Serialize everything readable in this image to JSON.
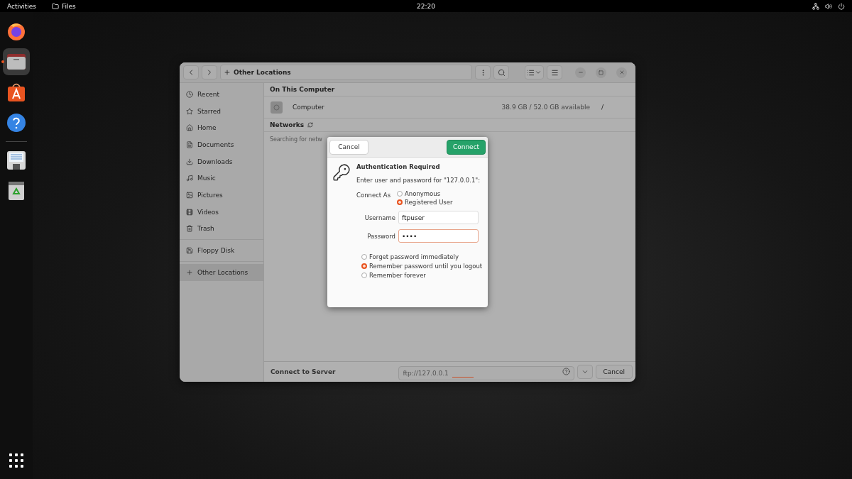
{
  "top_bar": {
    "activities": "Activities",
    "app_name": "Files",
    "clock": "22:20"
  },
  "dock": {
    "apps": [
      {
        "kind": "browser",
        "running": false
      },
      {
        "kind": "files",
        "running": true
      },
      {
        "kind": "store",
        "running": false
      },
      {
        "kind": "help",
        "running": false
      },
      {
        "kind": "floppy",
        "running": false
      },
      {
        "kind": "trash",
        "running": false
      }
    ]
  },
  "files_window": {
    "path": "Other Locations",
    "sidebar": [
      {
        "kind": "recent",
        "label": "Recent",
        "selected": false
      },
      {
        "kind": "starred",
        "label": "Starred",
        "selected": false
      },
      {
        "kind": "home",
        "label": "Home",
        "selected": false
      },
      {
        "kind": "documents",
        "label": "Documents",
        "selected": false
      },
      {
        "kind": "downloads",
        "label": "Downloads",
        "selected": false
      },
      {
        "kind": "music",
        "label": "Music",
        "selected": false
      },
      {
        "kind": "pictures",
        "label": "Pictures",
        "selected": false
      },
      {
        "kind": "videos",
        "label": "Videos",
        "selected": false
      },
      {
        "kind": "trash",
        "label": "Trash",
        "selected": false
      },
      {
        "kind": "floppy",
        "label": "Floppy Disk",
        "selected": false
      },
      {
        "kind": "other",
        "label": "Other Locations",
        "selected": true
      }
    ],
    "on_this_computer": {
      "title": "On This Computer",
      "items": [
        {
          "name": "Computer",
          "usage": "38.9 GB / 52.0 GB available",
          "mount": "/"
        }
      ]
    },
    "networks": {
      "title": "Networks",
      "status": "Searching for netw"
    },
    "connect_bar": {
      "label": "Connect to Server",
      "placeholder": "ftp://127.0.0.1",
      "cancel": "Cancel"
    }
  },
  "auth_dialog": {
    "cancel": "Cancel",
    "connect": "Connect",
    "title": "Authentication Required",
    "message": "Enter user and password for \"127.0.0.1\":",
    "connect_as_label": "Connect As",
    "connect_as": [
      {
        "label": "Anonymous",
        "selected": false
      },
      {
        "label": "Registered User",
        "selected": true
      }
    ],
    "username_label": "Username",
    "username": "ftpuser",
    "password_label": "Password",
    "password": "••••",
    "remember": [
      {
        "label": "Forget password immediately",
        "selected": false
      },
      {
        "label": "Remember password until you logout",
        "selected": true
      },
      {
        "label": "Remember forever",
        "selected": false
      }
    ]
  }
}
